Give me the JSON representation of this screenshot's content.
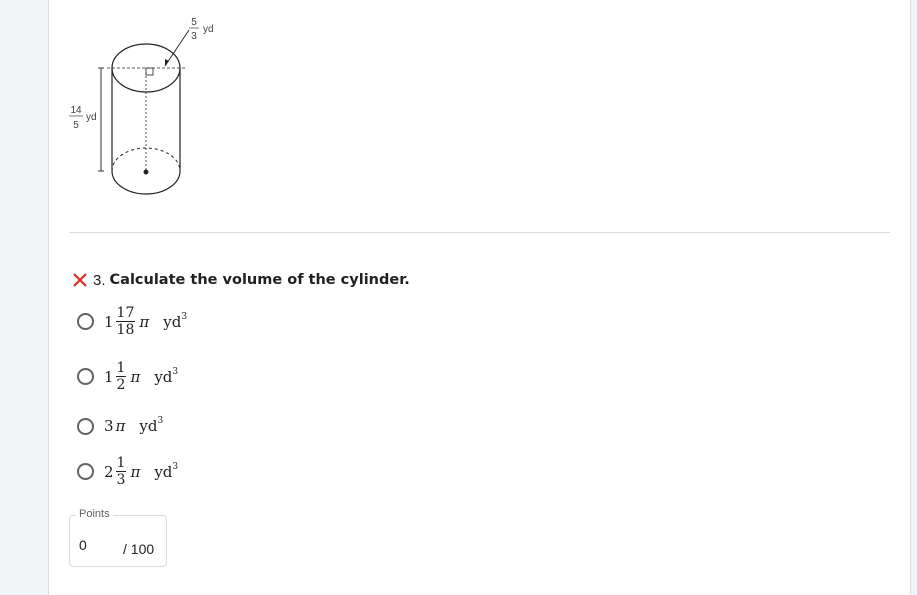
{
  "figure": {
    "radius_num": "5",
    "radius_den": "3",
    "radius_unit": "yd",
    "height_num": "14",
    "height_den": "5",
    "height_unit": "yd"
  },
  "question": {
    "number": "3.",
    "text": "Calculate the volume of the cylinder.",
    "status_icon": "x-mark-icon",
    "status_color": "#d93025"
  },
  "options": [
    {
      "whole": "1",
      "num": "17",
      "den": "18",
      "pi": "π",
      "unit": "yd",
      "exp": "3"
    },
    {
      "whole": "1",
      "num": "1",
      "den": "2",
      "pi": "π",
      "unit": "yd",
      "exp": "3"
    },
    {
      "whole": "3",
      "pi": "π",
      "unit": "yd",
      "exp": "3"
    },
    {
      "whole": "2",
      "num": "1",
      "den": "3",
      "pi": "π",
      "unit": "yd",
      "exp": "3"
    }
  ],
  "points": {
    "label": "Points",
    "value": "0",
    "total": "/ 100"
  }
}
